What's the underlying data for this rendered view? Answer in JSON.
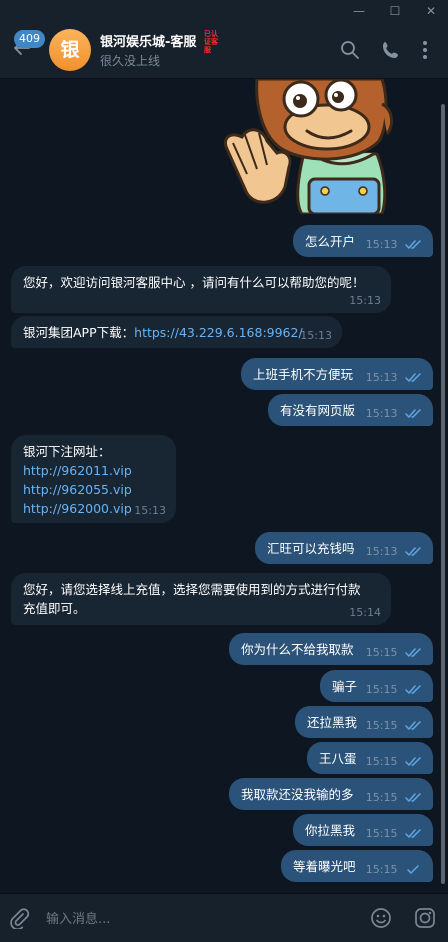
{
  "window": {
    "minimize_glyph": "—",
    "maximize_glyph": "☐",
    "close_glyph": "✕"
  },
  "header": {
    "unread_count": "409",
    "avatar_letter": "银",
    "title": "银河娱乐城-客服",
    "title_tag": "已认 证客 服",
    "status": "很久没上线",
    "icons": [
      "back-arrow-icon",
      "search-icon",
      "phone-icon",
      "more-vertical-icon"
    ]
  },
  "messages": [
    {
      "dir": "out",
      "text": "怎么开户",
      "time": "15:13"
    },
    {
      "dir": "in",
      "text": "您好，欢迎访问银河客服中心 ，请问有什么可以帮助您的呢！",
      "time": "15:13"
    },
    {
      "dir": "in",
      "text": "银河集团APP下载：",
      "link": "https://43.229.6.168:9962/",
      "time": "15:13"
    },
    {
      "dir": "out",
      "text": "上班手机不方便玩",
      "time": "15:13"
    },
    {
      "dir": "out",
      "text": "有没有网页版",
      "time": "15:13"
    },
    {
      "dir": "in",
      "text": "银河下注网址：",
      "links": [
        "http://962011.vip",
        "http://962055.vip",
        "http://962000.vip"
      ],
      "time": "15:13"
    },
    {
      "dir": "out",
      "text": "汇旺可以充钱吗",
      "time": "15:13"
    },
    {
      "dir": "in",
      "lines": [
        "您好，请您选择线上充值，选择您需要使用到的方式进行付款",
        "充值即可。"
      ],
      "time": "15:14"
    },
    {
      "dir": "out",
      "text": "你为什么不给我取款",
      "time": "15:15"
    },
    {
      "dir": "out",
      "text": "骗子",
      "time": "15:15"
    },
    {
      "dir": "out",
      "text": "还拉黑我",
      "time": "15:15"
    },
    {
      "dir": "out",
      "text": "王八蛋",
      "time": "15:15"
    },
    {
      "dir": "out",
      "text": "我取款还没我输的多",
      "time": "15:15"
    },
    {
      "dir": "out",
      "text": "你拉黑我",
      "time": "15:15"
    },
    {
      "dir": "out",
      "text": "等着曝光吧",
      "time": "15:15"
    }
  ],
  "composer": {
    "placeholder": "输入消息...",
    "icons": [
      "attach-icon",
      "emoji-icon",
      "camera-icon"
    ]
  },
  "colors": {
    "background": "#0e1621",
    "header": "#17212b",
    "outgoing_bubble": "#2b5278",
    "incoming_bubble": "#182533",
    "link": "#6ab3f3",
    "badge": "#3f88c5"
  }
}
